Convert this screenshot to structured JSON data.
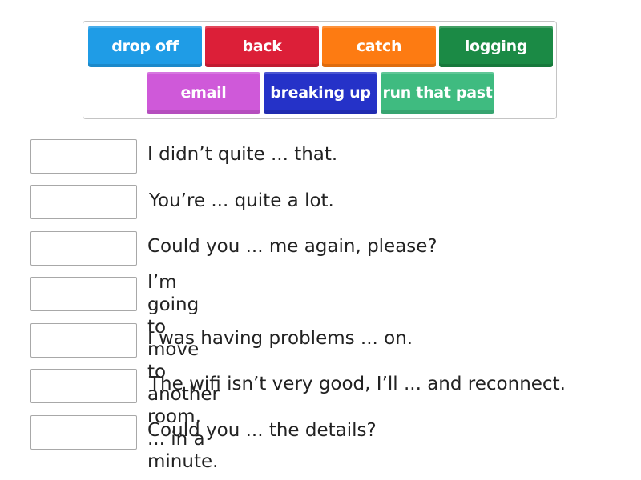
{
  "word_bank": {
    "tiles": [
      {
        "label": "drop off",
        "color": "#1f9ce6"
      },
      {
        "label": "back",
        "color": "#dc1f38"
      },
      {
        "label": "catch",
        "color": "#fd7b12"
      },
      {
        "label": "logging",
        "color": "#1b8a45"
      },
      {
        "label": "email",
        "color": "#cf59d9"
      },
      {
        "label": "breaking up",
        "color": "#2532c8"
      },
      {
        "label": "run that past",
        "color": "#3fbb80"
      }
    ]
  },
  "questions": [
    {
      "answer": "",
      "text": "I didn’t quite ... that."
    },
    {
      "answer": "",
      "text": "You’re ... quite a lot."
    },
    {
      "answer": "",
      "text": "Could you ... me again, please?"
    },
    {
      "answer": "",
      "text": "I’m going to move to another\nroom, ... in a minute."
    },
    {
      "answer": "",
      "text": "I was having problems ... on."
    },
    {
      "answer": "",
      "text": "The wifi isn’t very good, I’ll ... and reconnect."
    },
    {
      "answer": "",
      "text": "Could you ... the details?"
    }
  ]
}
